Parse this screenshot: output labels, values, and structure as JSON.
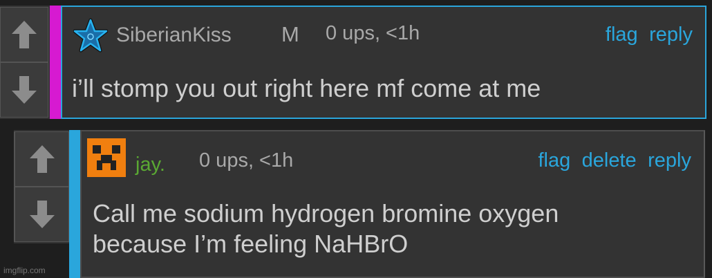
{
  "colors": {
    "accent_blue": "#2aa6dc",
    "magenta": "#d61ad1",
    "username_green": "#5aa833",
    "avatar_orange": "#f07f0f",
    "text": "#cfcfcf",
    "meta": "#a9a9a9"
  },
  "comments": [
    {
      "username": "SiberianKiss",
      "badge": "M",
      "stats": "0 ups, <1h",
      "avatar_icon": "star-icon",
      "actions": [
        "flag",
        "reply"
      ],
      "text": "i’ll stomp you out right here mf come at me",
      "upvote_icon": "arrow-up-icon",
      "downvote_icon": "arrow-down-icon"
    },
    {
      "username": "jay.",
      "stats": "0 ups, <1h",
      "avatar_icon": "creeper-face-icon",
      "actions": [
        "flag",
        "delete",
        "reply"
      ],
      "text": "Call me sodium hydrogen bromine oxygen\nbecause I’m feeling NaHBrO",
      "upvote_icon": "arrow-up-icon",
      "downvote_icon": "arrow-down-icon"
    }
  ],
  "watermark": "imgflip.com"
}
